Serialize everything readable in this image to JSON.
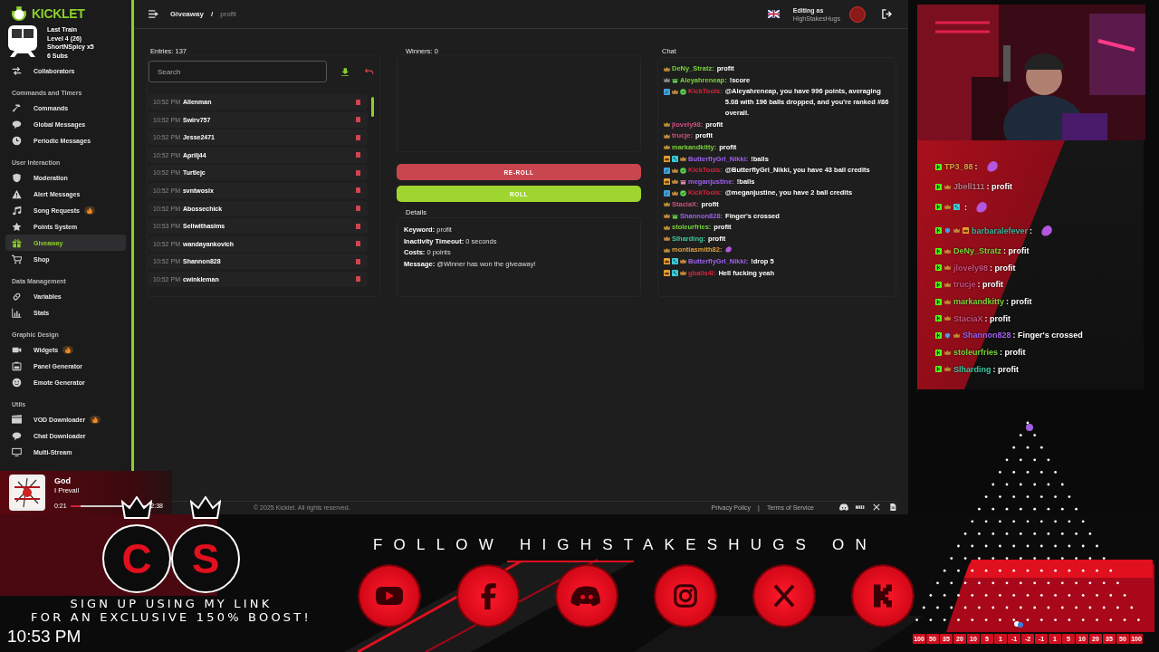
{
  "alert_overlay": {
    "lines": [
      "Last Train",
      "Level 4 (26)",
      "ShortNSpicy x5",
      "6 Subs"
    ]
  },
  "sidebar": {
    "logo": "KICKLET",
    "sections": [
      {
        "items": [
          {
            "label": "Collaborators",
            "kind": "arrows",
            "hot": false,
            "selected": false
          }
        ]
      },
      {
        "title": "Commands and Timers",
        "items": [
          {
            "label": "Commands",
            "kind": "hammer",
            "hot": false,
            "selected": false
          },
          {
            "label": "Global Messages",
            "kind": "bubble",
            "hot": false,
            "selected": false
          },
          {
            "label": "Periodic Messages",
            "kind": "clock",
            "hot": false,
            "selected": false
          }
        ]
      },
      {
        "title": "User Interaction",
        "items": [
          {
            "label": "Moderation",
            "kind": "shield",
            "hot": false,
            "selected": false
          },
          {
            "label": "Alert Messages",
            "kind": "warning",
            "hot": false,
            "selected": false
          },
          {
            "label": "Song Requests",
            "kind": "music",
            "hot": true,
            "selected": false
          },
          {
            "label": "Points System",
            "kind": "star",
            "hot": false,
            "selected": false
          },
          {
            "label": "Giveaway",
            "kind": "gift",
            "hot": false,
            "selected": true
          },
          {
            "label": "Shop",
            "kind": "cart",
            "hot": false,
            "selected": false
          }
        ]
      },
      {
        "title": "Data Management",
        "items": [
          {
            "label": "Variables",
            "kind": "link",
            "hot": false,
            "selected": false
          },
          {
            "label": "Stats",
            "kind": "bars",
            "hot": false,
            "selected": false
          }
        ]
      },
      {
        "title": "Graphic Design",
        "items": [
          {
            "label": "Widgets",
            "kind": "camera",
            "hot": true,
            "selected": false
          },
          {
            "label": "Panel Generator",
            "kind": "frame",
            "hot": false,
            "selected": false
          },
          {
            "label": "Emote Generator",
            "kind": "smiley",
            "hot": false,
            "selected": false
          }
        ]
      },
      {
        "title": "Utils",
        "items": [
          {
            "label": "VOD Downloader",
            "kind": "film",
            "hot": true,
            "selected": false
          },
          {
            "label": "Chat Downloader",
            "kind": "bubble",
            "hot": false,
            "selected": false
          },
          {
            "label": "Multi-Stream",
            "kind": "monitor",
            "hot": false,
            "selected": false
          }
        ]
      }
    ]
  },
  "header": {
    "breadcrumb": [
      "Giveaway",
      "/",
      "profit"
    ],
    "account_label": "Editing as",
    "account_name": "HighStakesHugs"
  },
  "entries": {
    "title": "Entries: 137",
    "search": {
      "placeholder": "Search"
    },
    "rows": [
      {
        "time": "10:52 PM",
        "name": "Allenman"
      },
      {
        "time": "10:52 PM",
        "name": "Swirv757"
      },
      {
        "time": "10:52 PM",
        "name": "Jesse2471"
      },
      {
        "time": "10:52 PM",
        "name": "Aprilj44"
      },
      {
        "time": "10:52 PM",
        "name": "Turtlejc"
      },
      {
        "time": "10:52 PM",
        "name": "svntwosix"
      },
      {
        "time": "10:52 PM",
        "name": "Abossechick"
      },
      {
        "time": "10:53 PM",
        "name": "Sellwithasims"
      },
      {
        "time": "10:52 PM",
        "name": "wandayankovich"
      },
      {
        "time": "10:52 PM",
        "name": "Shannon828"
      },
      {
        "time": "10:52 PM",
        "name": "cwinkleman"
      }
    ]
  },
  "winners": {
    "title": "Winners: 0",
    "buttons": [
      {
        "label": "RE-ROLL",
        "kind": "reroll"
      },
      {
        "label": "ROLL",
        "kind": "roll"
      }
    ]
  },
  "details": {
    "title": "Details",
    "lines": [
      "**Keyword:** profit",
      "**Inactivity Timeout:** 0 seconds",
      "**Costs:** 0 points",
      "**Message:** @Winner has won the giveaway!"
    ]
  },
  "chat": {
    "title": "Chat",
    "messages": [
      {
        "badges": [
          {
            "kind": "crown"
          }
        ],
        "user": "DeNy_Stratz:",
        "color": "#7bd23a",
        "text": "profit",
        "emote": false
      },
      {
        "badges": [
          {
            "kind": "crown-silver"
          },
          {
            "kind": "gift"
          }
        ],
        "user": "Aleyahreneap:",
        "color": "#7bd23a",
        "text": "!score",
        "emote": false
      },
      {
        "badges": [
          {
            "kind": "bot"
          },
          {
            "kind": "crown"
          },
          {
            "kind": "verified"
          }
        ],
        "user": "KickTools:",
        "color": "#e0203a",
        "text": "@Aleyahreneap, you have 996 points, averaging 5.08 with 196 balls dropped, and you're ranked #86 overall.",
        "emote": false
      },
      {
        "badges": [
          {
            "kind": "crown"
          }
        ],
        "user": "jlovely98:",
        "color": "#d05080",
        "text": "profit",
        "emote": false
      },
      {
        "badges": [
          {
            "kind": "crown"
          }
        ],
        "user": "trucje:",
        "color": "#d05080",
        "text": "profit",
        "emote": false
      },
      {
        "badges": [
          {
            "kind": "crown"
          }
        ],
        "user": "markandkitty:",
        "color": "#7bd23a",
        "text": "profit",
        "emote": false
      },
      {
        "badges": [
          {
            "kind": "founder"
          },
          {
            "kind": "subscriber"
          },
          {
            "kind": "crown"
          }
        ],
        "user": "ButterflyGrl_Nikki:",
        "color": "#a060f0",
        "text": "!balls",
        "emote": false
      },
      {
        "badges": [
          {
            "kind": "bot"
          },
          {
            "kind": "crown"
          },
          {
            "kind": "verified"
          }
        ],
        "user": "KickTools:",
        "color": "#e0203a",
        "text": "@ButterflyGrl_Nikki, you have 43 ball credits",
        "emote": false
      },
      {
        "badges": [
          {
            "kind": "founder"
          },
          {
            "kind": "crown"
          },
          {
            "kind": "gift-pink"
          }
        ],
        "user": "meganjustine:",
        "color": "#a060f0",
        "text": "!balls",
        "emote": false
      },
      {
        "badges": [
          {
            "kind": "bot"
          },
          {
            "kind": "crown"
          },
          {
            "kind": "verified"
          }
        ],
        "user": "KickTools:",
        "color": "#e0203a",
        "text": "@meganjustine, you have 2 ball credits",
        "emote": false
      },
      {
        "badges": [
          {
            "kind": "crown"
          }
        ],
        "user": "StaciaX:",
        "color": "#d05080",
        "text": "profit",
        "emote": false
      },
      {
        "badges": [
          {
            "kind": "crown"
          },
          {
            "kind": "gift"
          }
        ],
        "user": "Shannon828:",
        "color": "#a060f0",
        "text": "Finger's crossed",
        "emote": false
      },
      {
        "badges": [
          {
            "kind": "crown"
          }
        ],
        "user": "stoleurfries:",
        "color": "#7bd23a",
        "text": "profit",
        "emote": false
      },
      {
        "badges": [
          {
            "kind": "crown"
          }
        ],
        "user": "Slharding:",
        "color": "#3cc9a0",
        "text": "profit",
        "emote": false
      },
      {
        "badges": [
          {
            "kind": "crown"
          }
        ],
        "user": "montiasmith82:",
        "color": "#e0a040",
        "emote": true
      },
      {
        "badges": [
          {
            "kind": "founder"
          },
          {
            "kind": "subscriber"
          },
          {
            "kind": "crown"
          }
        ],
        "user": "ButterflyGrl_Nikki:",
        "color": "#a060f0",
        "text": "!drop 5",
        "emote": false
      },
      {
        "badges": [
          {
            "kind": "founder"
          },
          {
            "kind": "subscriber"
          },
          {
            "kind": "crown"
          }
        ],
        "user": "gballs4l:",
        "color": "#e0203a",
        "text": "Hell fucking yeah",
        "emote": false
      }
    ]
  },
  "footer": {
    "copyright": "© 2025 Kicklet. All rights reserved.",
    "links": [
      "Privacy Policy",
      "|",
      "Terms of Service"
    ]
  },
  "music_player": {
    "title": "God",
    "artist": "I Prevail",
    "elapsed": "0:21",
    "duration": "2:38",
    "level": 0.13
  },
  "stream_chat": {
    "messages": [
      {
        "badges": [
          {
            "kind": "kick"
          }
        ],
        "user": "TP3_88",
        "color": "#e0a040",
        "text": ":",
        "emote": true
      },
      {
        "badges": [
          {
            "kind": "kick"
          },
          {
            "kind": "crown"
          }
        ],
        "user": "Jbell111",
        "color": "#c07a8a",
        "text": ": profit",
        "emote": false
      },
      {
        "badges": [
          {
            "kind": "kick"
          },
          {
            "kind": "crown"
          },
          {
            "kind": "subscriber"
          }
        ],
        "text": ":",
        "emote": true
      },
      {
        "badges": [
          {
            "kind": "kick"
          },
          {
            "kind": "cube"
          },
          {
            "kind": "crown"
          },
          {
            "kind": "founder"
          }
        ],
        "user": "barbaralefever",
        "color": "#3cb39c",
        "text": ":",
        "emote": true
      },
      {
        "badges": [
          {
            "kind": "kick"
          },
          {
            "kind": "crown"
          }
        ],
        "user": "DeNy_Stratz",
        "color": "#7bd23a",
        "text": ": profit",
        "emote": false
      },
      {
        "badges": [
          {
            "kind": "kick"
          },
          {
            "kind": "crown"
          }
        ],
        "user": "jlovely98",
        "color": "#d05080",
        "text": ": profit",
        "emote": false
      },
      {
        "badges": [
          {
            "kind": "kick"
          },
          {
            "kind": "crown"
          }
        ],
        "user": "trucje",
        "color": "#d05080",
        "text": ": profit",
        "emote": false
      },
      {
        "badges": [
          {
            "kind": "kick"
          },
          {
            "kind": "crown"
          }
        ],
        "user": "markandkitty",
        "color": "#7bd23a",
        "text": ": profit",
        "emote": false
      },
      {
        "badges": [
          {
            "kind": "kick"
          },
          {
            "kind": "crown"
          }
        ],
        "user": "StaciaX",
        "color": "#d05080",
        "text": ": profit",
        "emote": false
      },
      {
        "badges": [
          {
            "kind": "kick"
          },
          {
            "kind": "cube"
          },
          {
            "kind": "crown"
          }
        ],
        "user": "Shannon828",
        "color": "#a060f0",
        "text": ": Finger's crossed",
        "emote": false
      },
      {
        "badges": [
          {
            "kind": "kick"
          },
          {
            "kind": "crown"
          }
        ],
        "user": "stoleurfries",
        "color": "#7bd23a",
        "text": ": profit",
        "emote": false
      },
      {
        "badges": [
          {
            "kind": "kick"
          },
          {
            "kind": "crown"
          }
        ],
        "user": "Slharding",
        "color": "#3cc9a0",
        "text": ": profit",
        "emote": false
      }
    ]
  },
  "banner": {
    "logo_letters": [
      "C",
      "S"
    ],
    "signup_lines": [
      "SIGN UP USING MY LINK",
      "FOR AN EXCLUSIVE 150% BOOST!"
    ],
    "clock": "10:53 PM",
    "follow_text": "FOLLOW HIGHSTAKESHUGS ON",
    "socials": [
      {
        "kind": "youtube"
      },
      {
        "kind": "facebook"
      },
      {
        "kind": "discord"
      },
      {
        "kind": "instagram"
      },
      {
        "kind": "x"
      },
      {
        "kind": "kick"
      }
    ]
  },
  "plinko": {
    "multipliers": [
      "100",
      "50",
      "35",
      "20",
      "10",
      "5",
      "1",
      "-1",
      "-2",
      "-1",
      "1",
      "5",
      "10",
      "20",
      "35",
      "50",
      "100"
    ]
  }
}
